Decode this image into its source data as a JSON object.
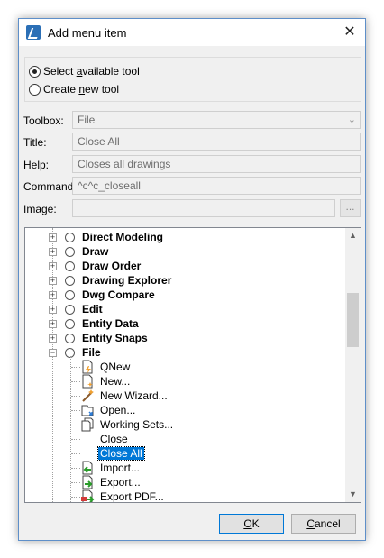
{
  "window": {
    "title": "Add menu item"
  },
  "mode": {
    "options": [
      {
        "pre": "Select ",
        "key": "a",
        "post": "vailable tool",
        "checked": true
      },
      {
        "pre": "Create ",
        "key": "n",
        "post": "ew tool",
        "checked": false
      }
    ]
  },
  "fields": {
    "toolbox_label": "Toolbox:",
    "toolbox_value": "File",
    "title_label": "Title:",
    "title_value": "Close All",
    "help_label": "Help:",
    "help_value": "Closes all drawings",
    "command_label": "Command:",
    "command_value": "^c^c_closeall",
    "image_label": "Image:",
    "image_value": "",
    "browse_label": "..."
  },
  "tree": {
    "groups": [
      "Direct Modeling",
      "Draw",
      "Draw Order",
      "Drawing Explorer",
      "Dwg Compare",
      "Edit",
      "Entity Data",
      "Entity Snaps",
      "File"
    ],
    "commands": [
      "QNew",
      "New...",
      "New Wizard...",
      "Open...",
      "Working Sets...",
      "Close",
      "Close All",
      "Import...",
      "Export...",
      "Export PDF..."
    ],
    "selected": "Close All"
  },
  "buttons": {
    "ok_key": "O",
    "ok_rest": "K",
    "cancel_key": "C",
    "cancel_rest": "ancel"
  },
  "colors": {
    "selection": "#0078d7",
    "title_bar": "#ffffff",
    "dialog_bg": "#f0f0f0"
  }
}
